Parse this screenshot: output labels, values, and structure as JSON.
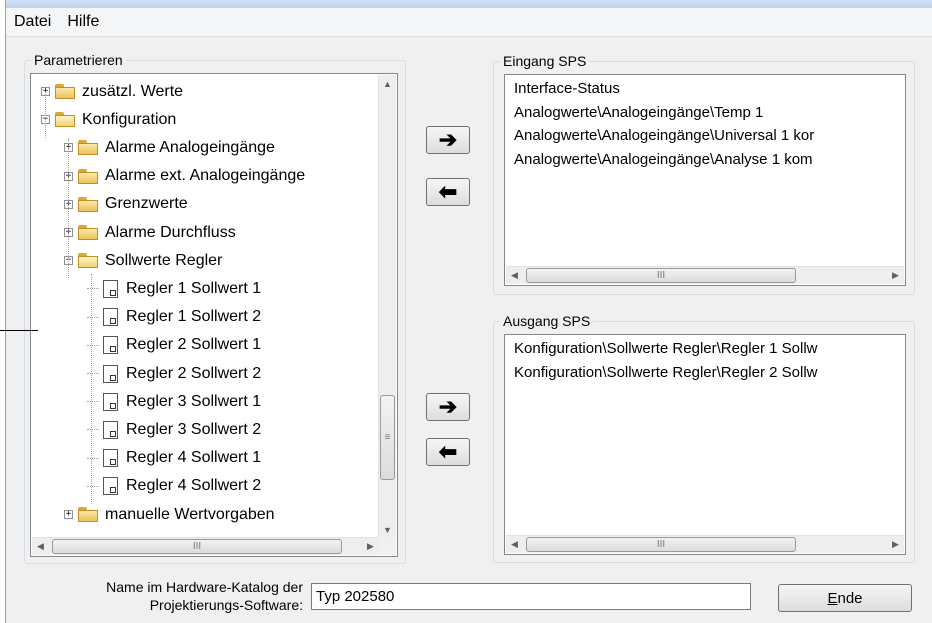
{
  "menu": {
    "items": [
      "Datei",
      "Hilfe"
    ]
  },
  "parametrieren": {
    "label": "Parametrieren",
    "tree": [
      {
        "label": "zusätzl. Werte",
        "level": 0,
        "kind": "folder",
        "expander": "+"
      },
      {
        "label": "Konfiguration",
        "level": 0,
        "kind": "folder-open",
        "expander": "−"
      },
      {
        "label": "Alarme Analogeingänge",
        "level": 1,
        "kind": "folder",
        "expander": "+"
      },
      {
        "label": "Alarme ext. Analogeingänge",
        "level": 1,
        "kind": "folder",
        "expander": "+"
      },
      {
        "label": "Grenzwerte",
        "level": 1,
        "kind": "folder",
        "expander": "+"
      },
      {
        "label": "Alarme Durchfluss",
        "level": 1,
        "kind": "folder",
        "expander": "+"
      },
      {
        "label": "Sollwerte Regler",
        "level": 1,
        "kind": "folder-open",
        "expander": "−"
      },
      {
        "label": "Regler 1 Sollwert 1",
        "level": 2,
        "kind": "doc"
      },
      {
        "label": "Regler 1 Sollwert 2",
        "level": 2,
        "kind": "doc"
      },
      {
        "label": "Regler 2 Sollwert 1",
        "level": 2,
        "kind": "doc"
      },
      {
        "label": "Regler 2 Sollwert 2",
        "level": 2,
        "kind": "doc"
      },
      {
        "label": "Regler 3 Sollwert 1",
        "level": 2,
        "kind": "doc"
      },
      {
        "label": "Regler 3 Sollwert 2",
        "level": 2,
        "kind": "doc"
      },
      {
        "label": "Regler 4 Sollwert 1",
        "level": 2,
        "kind": "doc"
      },
      {
        "label": "Regler 4 Sollwert 2",
        "level": 2,
        "kind": "doc"
      },
      {
        "label": "manuelle Wertvorgaben",
        "level": 1,
        "kind": "folder",
        "expander": "+"
      }
    ]
  },
  "eingang": {
    "label": "Eingang SPS",
    "items": [
      "Interface-Status",
      "Analogwerte\\Analogeingänge\\Temp 1",
      "Analogwerte\\Analogeingänge\\Universal 1 kor",
      "Analogwerte\\Analogeingänge\\Analyse 1 kom"
    ]
  },
  "ausgang": {
    "label": "Ausgang SPS",
    "items": [
      "Konfiguration\\Sollwerte Regler\\Regler 1 Sollw",
      "Konfiguration\\Sollwerte Regler\\Regler 2 Sollw"
    ]
  },
  "buttons": {
    "add_arrow": "➔",
    "remove_arrow": "⬅",
    "end_prefix": "",
    "end_mnemonic": "E",
    "end_rest": "nde"
  },
  "catalog": {
    "label_line1": "Name im Hardware-Katalog der",
    "label_line2": "Projektierungs-Software:",
    "value": "Typ 202580"
  },
  "scroll": {
    "thumb_glyph_h": "III",
    "thumb_glyph_v": "≡"
  }
}
